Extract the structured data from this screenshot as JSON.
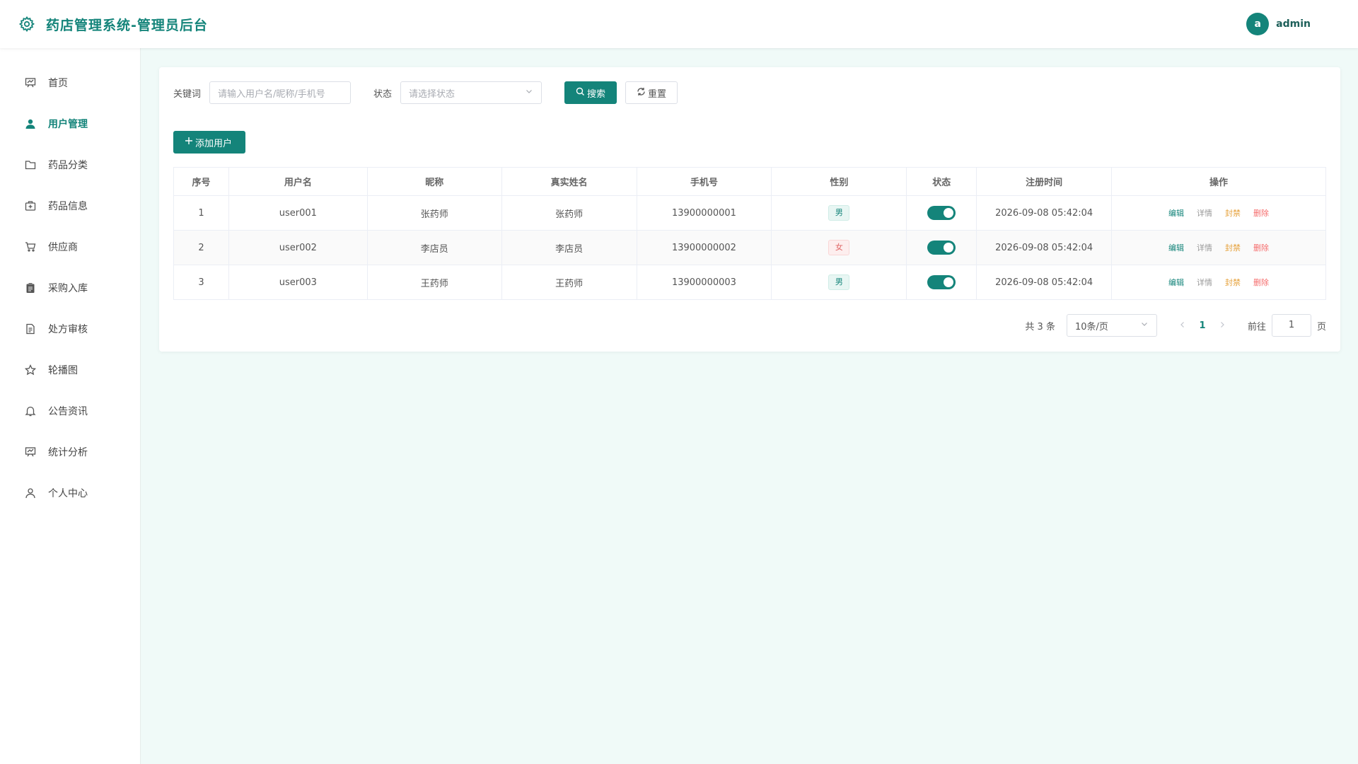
{
  "header": {
    "title": "药店管理系统-管理员后台",
    "avatar_letter": "a",
    "username": "admin"
  },
  "sidebar": {
    "items": [
      {
        "label": "首页",
        "icon": "dashboard-icon"
      },
      {
        "label": "用户管理",
        "icon": "user-icon",
        "active": true
      },
      {
        "label": "药品分类",
        "icon": "folder-icon"
      },
      {
        "label": "药品信息",
        "icon": "medkit-icon"
      },
      {
        "label": "供应商",
        "icon": "cart-icon"
      },
      {
        "label": "采购入库",
        "icon": "clipboard-icon"
      },
      {
        "label": "处方审核",
        "icon": "document-icon"
      },
      {
        "label": "轮播图",
        "icon": "star-icon"
      },
      {
        "label": "公告资讯",
        "icon": "bell-icon"
      },
      {
        "label": "统计分析",
        "icon": "chart-board-icon"
      },
      {
        "label": "个人中心",
        "icon": "person-icon"
      }
    ]
  },
  "search": {
    "keyword_label": "关键词",
    "keyword_placeholder": "请输入用户名/昵称/手机号",
    "status_label": "状态",
    "status_placeholder": "请选择状态",
    "search_button": "搜索",
    "reset_button": "重置"
  },
  "add_button": "添加用户",
  "table": {
    "columns": [
      "序号",
      "用户名",
      "昵称",
      "真实姓名",
      "手机号",
      "性别",
      "状态",
      "注册时间",
      "操作"
    ],
    "rows": [
      {
        "index": "1",
        "username": "user001",
        "nickname": "张药师",
        "realname": "张药师",
        "phone": "13900000001",
        "gender": "男",
        "status_on": true,
        "registered": "2026-09-08 05:42:04"
      },
      {
        "index": "2",
        "username": "user002",
        "nickname": "李店员",
        "realname": "李店员",
        "phone": "13900000002",
        "gender": "女",
        "status_on": true,
        "registered": "2026-09-08 05:42:04"
      },
      {
        "index": "3",
        "username": "user003",
        "nickname": "王药师",
        "realname": "王药师",
        "phone": "13900000003",
        "gender": "男",
        "status_on": true,
        "registered": "2026-09-08 05:42:04"
      }
    ],
    "actions": {
      "edit": "编辑",
      "detail": "详情",
      "ban": "封禁",
      "delete": "删除"
    }
  },
  "pagination": {
    "total": "共 3 条",
    "page_size": "10条/页",
    "current_page": "1",
    "goto_label": "前往",
    "goto_value": "1",
    "page_suffix": "页"
  },
  "colors": {
    "primary": "#14847a",
    "background": "#f0faf8",
    "male_tag": "#14847a",
    "female_tag": "#e06666",
    "ban": "#e6a23c",
    "delete": "#f56c6c"
  }
}
